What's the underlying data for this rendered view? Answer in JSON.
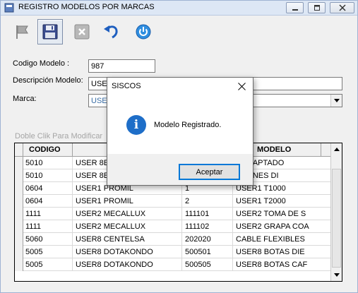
{
  "window": {
    "title": "REGISTRO MODELOS POR MARCAS"
  },
  "form": {
    "codigo_label": "Codigo Modelo :",
    "codigo_value": "987",
    "descripcion_label": "Descripción Modelo:",
    "descripcion_value": "USE",
    "marca_label": "Marca:",
    "marca_value": "USE"
  },
  "grid": {
    "hint": "Doble Clik Para Modificar",
    "headers": [
      "CODIGO",
      "",
      "",
      "MODELO"
    ],
    "rows": [
      [
        "5010",
        "USER 8E",
        "",
        "5 ADAPTADO"
      ],
      [
        "5010",
        "USER 8E",
        "",
        "8 ARNES DI"
      ],
      [
        "0604",
        "USER1 PROMIL",
        "1",
        "USER1 T1000"
      ],
      [
        "0604",
        "USER1 PROMIL",
        "2",
        "USER1 T2000"
      ],
      [
        "1111",
        "USER2 MECALLUX",
        "111101",
        "USER2 TOMA DE S"
      ],
      [
        "1111",
        "USER2 MECALLUX",
        "111102",
        "USER2 GRAPA COA"
      ],
      [
        "5060",
        "USER8 CENTELSA",
        "202020",
        "CABLE FLEXIBLES"
      ],
      [
        "5005",
        "USER8 DOTAKONDO",
        "500501",
        "USER8 BOTAS DIE"
      ],
      [
        "5005",
        "USER8 DOTAKONDO",
        "500505",
        "USER8 BOTAS CAF"
      ]
    ]
  },
  "dialog": {
    "title": "SISCOS",
    "message": "Modelo Registrado.",
    "ok_label": "Aceptar"
  },
  "colors": {
    "dialog_border": "#0078d7",
    "info_icon": "#1e6ec8"
  }
}
